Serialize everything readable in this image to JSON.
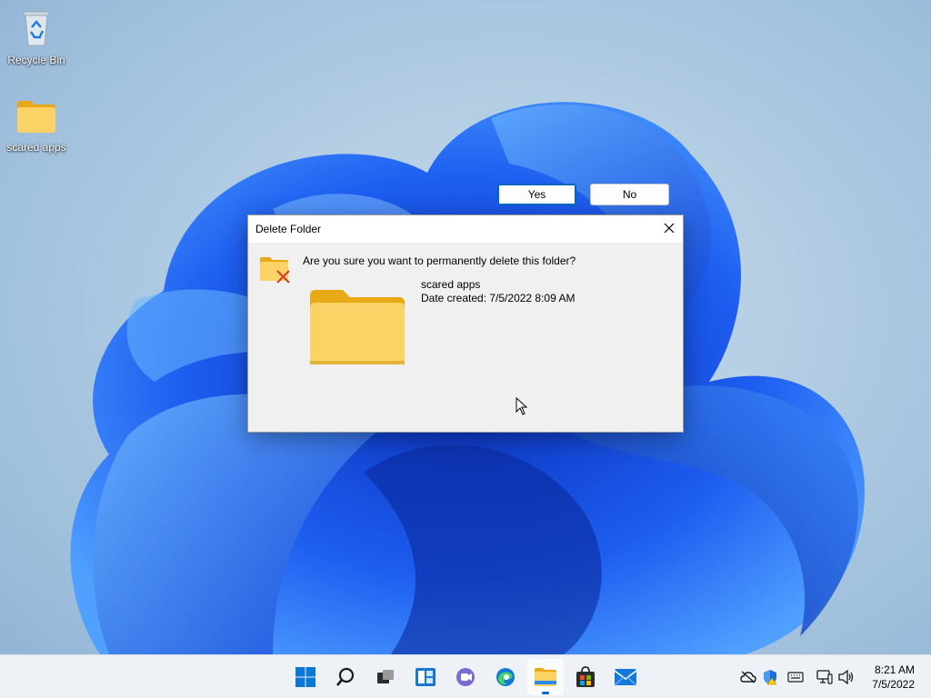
{
  "desktop": {
    "icons": [
      {
        "label": "Recycle Bin"
      },
      {
        "label": "scared apps"
      }
    ]
  },
  "dialog": {
    "title": "Delete Folder",
    "question": "Are you sure you want to permanently delete this folder?",
    "item_name": "scared apps",
    "item_date": "Date created: 7/5/2022 8:09 AM",
    "yes_label": "Yes",
    "no_label": "No",
    "close_icon": "close-icon"
  },
  "taskbar": {
    "apps": [
      {
        "name": "start",
        "icon": "windows-logo-icon"
      },
      {
        "name": "search",
        "icon": "search-icon"
      },
      {
        "name": "task-view",
        "icon": "task-view-icon"
      },
      {
        "name": "widgets",
        "icon": "widgets-icon"
      },
      {
        "name": "chat",
        "icon": "teams-chat-icon"
      },
      {
        "name": "edge",
        "icon": "edge-icon"
      },
      {
        "name": "file-explorer",
        "icon": "folder-icon",
        "active": true
      },
      {
        "name": "store",
        "icon": "store-icon"
      },
      {
        "name": "mail",
        "icon": "mail-icon"
      }
    ],
    "tray": [
      "onedrive-icon",
      "defender-icon",
      "keyboard-icon",
      "network-icon",
      "volume-icon"
    ],
    "time": "8:21 AM",
    "date": "7/5/2022"
  },
  "colors": {
    "accent": "#0067c0",
    "folder_yellow": "#f8c94a",
    "wallpaper_blue": "#1a5be8"
  }
}
